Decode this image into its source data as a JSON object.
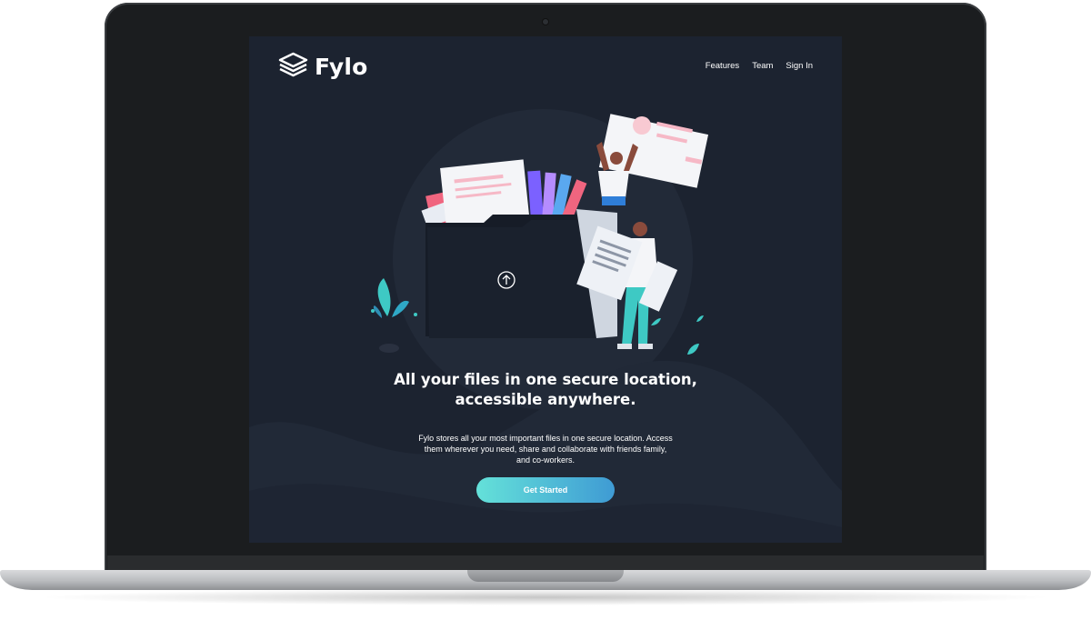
{
  "brand": {
    "name": "Fylo",
    "logo_icon": "layers-icon"
  },
  "nav": {
    "items": [
      "Features",
      "Team",
      "Sign In"
    ]
  },
  "hero": {
    "title_line1": "All your files in one secure location,",
    "title_line2": "accessible anywhere.",
    "description": "Fylo stores all your most important files in one secure location. Access them wherever you need, share and collaborate with friends family, and co-workers.",
    "cta_label": "Get Started"
  },
  "colors": {
    "screen_background": "#1c2330",
    "cta_gradient_start": "#64e1d9",
    "cta_gradient_end": "#3f9bd4",
    "accent_pink": "#f0657f",
    "accent_teal": "#3ec9c4"
  }
}
